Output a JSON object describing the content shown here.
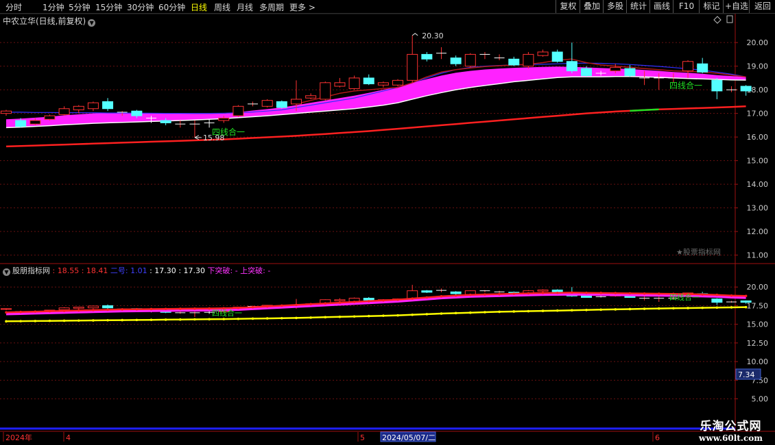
{
  "toolbar": {
    "periods": [
      "分时",
      "1分钟",
      "5分钟",
      "15分钟",
      "30分钟",
      "60分钟",
      "日线",
      "周线",
      "月线",
      "多周期",
      "更多 >"
    ],
    "active_period": "日线",
    "right_buttons": [
      "复权",
      "叠加",
      "多股",
      "统计",
      "画线",
      "F10",
      "标记",
      "+自选",
      "返回"
    ]
  },
  "stock_title": "中农立华(日线,前复权)",
  "indicator_title": {
    "name": "股朋指标网",
    "v1": ": 18.55",
    "v2": ": 18.41",
    "v3_label": "二号",
    "v3": ": 1.01",
    "v4": ": 17.30",
    "v5": ": 17.30",
    "breakdown": "下突破: -",
    "breakout": "上突破: -"
  },
  "annotations": {
    "high": "20.30",
    "low": "15.98",
    "four_line_upper_left": "四线合一",
    "four_line_upper_right": "四线合一",
    "four_line_lower_left": "四线合一",
    "four_line_lower_right": "四线合一"
  },
  "watermark": "★股票指标网",
  "crosshair_value": "7.34",
  "time_axis": {
    "year": "2024年",
    "m4": "4",
    "m5": "5",
    "selected_date": "2024/05/07/二",
    "m6": "6"
  },
  "logo": {
    "line1": "乐淘公式网",
    "line2": "www.60lt.com"
  },
  "colors": {
    "up": "#ff3232",
    "down": "#54ffff",
    "ribbon": "#ff22ff",
    "ma_long": "#ff2020",
    "ma_short": "#b01818",
    "ma_white": "#ffffff",
    "ma_blue": "#3030ff",
    "yellow": "#ffff00"
  },
  "chart_data": {
    "type": "candlestick",
    "main_axis": {
      "ylim": [
        10.7,
        20.7
      ],
      "ticks": [
        "20.00",
        "19.00",
        "18.00",
        "17.00",
        "16.00",
        "15.00",
        "14.00",
        "13.00",
        "12.00",
        "11.00"
      ]
    },
    "indicator_axis": {
      "ylim": [
        3.4,
        21.4
      ],
      "ticks": [
        "20.00",
        "17.50",
        "15.00",
        "12.50",
        "10.00",
        "7.50",
        "5.00"
      ]
    },
    "candles": [
      [
        17.0,
        17.1,
        16.9,
        17.15
      ],
      [
        16.7,
        16.45,
        16.4,
        16.8
      ],
      [
        16.55,
        16.7,
        16.5,
        16.8
      ],
      [
        16.75,
        16.9,
        16.7,
        16.95
      ],
      [
        16.95,
        17.2,
        16.9,
        17.3
      ],
      [
        17.15,
        17.3,
        17.0,
        17.35
      ],
      [
        17.2,
        17.45,
        17.1,
        17.5
      ],
      [
        17.5,
        17.2,
        17.1,
        17.65
      ],
      [
        17.0,
        17.05,
        16.9,
        17.1
      ],
      [
        17.1,
        16.9,
        16.8,
        17.15
      ],
      [
        16.8,
        16.75,
        16.6,
        16.9
      ],
      [
        16.7,
        16.6,
        16.5,
        16.8
      ],
      [
        16.55,
        16.55,
        16.4,
        16.7
      ],
      [
        16.5,
        16.55,
        15.98,
        16.7
      ],
      [
        16.6,
        16.55,
        16.4,
        16.75
      ],
      [
        16.7,
        16.8,
        16.6,
        16.9
      ],
      [
        16.9,
        17.3,
        16.85,
        17.35
      ],
      [
        17.4,
        17.4,
        17.3,
        17.5
      ],
      [
        17.3,
        17.55,
        17.25,
        17.6
      ],
      [
        17.5,
        17.25,
        17.2,
        17.55
      ],
      [
        17.4,
        17.6,
        17.1,
        18.4
      ],
      [
        17.65,
        17.75,
        17.6,
        17.85
      ],
      [
        17.6,
        18.3,
        17.55,
        18.35
      ],
      [
        18.15,
        18.3,
        18.1,
        18.5
      ],
      [
        18.05,
        18.5,
        18.0,
        18.6
      ],
      [
        18.5,
        18.25,
        18.2,
        18.65
      ],
      [
        18.2,
        18.3,
        18.1,
        18.35
      ],
      [
        18.2,
        18.4,
        18.15,
        18.45
      ],
      [
        18.4,
        19.5,
        18.3,
        20.3
      ],
      [
        19.5,
        19.3,
        19.2,
        19.6
      ],
      [
        19.55,
        19.55,
        19.3,
        19.8
      ],
      [
        19.35,
        19.1,
        19.0,
        19.45
      ],
      [
        19.0,
        19.5,
        18.95,
        19.55
      ],
      [
        19.5,
        19.5,
        19.3,
        19.6
      ],
      [
        19.35,
        19.35,
        19.25,
        19.5
      ],
      [
        19.3,
        19.05,
        19.0,
        19.4
      ],
      [
        19.0,
        19.5,
        18.9,
        19.6
      ],
      [
        19.45,
        19.6,
        19.4,
        19.7
      ],
      [
        19.6,
        19.2,
        19.15,
        19.7
      ],
      [
        19.2,
        18.8,
        18.7,
        20.0
      ],
      [
        18.9,
        18.6,
        18.55,
        19.0
      ],
      [
        18.7,
        18.65,
        18.6,
        18.8
      ],
      [
        18.8,
        18.95,
        18.7,
        19.1
      ],
      [
        18.9,
        18.6,
        18.55,
        19.05
      ],
      [
        18.5,
        18.5,
        18.2,
        18.8
      ],
      [
        18.5,
        18.5,
        18.0,
        18.7
      ],
      [
        18.5,
        18.5,
        18.3,
        18.7
      ],
      [
        18.8,
        19.2,
        18.5,
        19.25
      ],
      [
        19.1,
        18.75,
        18.7,
        19.35
      ],
      [
        18.4,
        17.95,
        17.6,
        18.5
      ],
      [
        18.0,
        18.0,
        17.9,
        18.15
      ],
      [
        18.15,
        17.95,
        17.75,
        18.2
      ]
    ],
    "ma_long": [
      15.6,
      15.62,
      15.64,
      15.66,
      15.68,
      15.7,
      15.72,
      15.74,
      15.76,
      15.78,
      15.8,
      15.82,
      15.84,
      15.86,
      15.88,
      15.9,
      15.93,
      15.96,
      15.99,
      16.02,
      16.05,
      16.09,
      16.13,
      16.17,
      16.21,
      16.25,
      16.3,
      16.35,
      16.4,
      16.45,
      16.5,
      16.55,
      16.6,
      16.65,
      16.7,
      16.75,
      16.8,
      16.85,
      16.9,
      16.95,
      17.0,
      17.04,
      17.08,
      17.11,
      17.14,
      17.17,
      17.19,
      17.21,
      17.23,
      17.25,
      17.27,
      17.3
    ],
    "ma_white": [
      16.4,
      16.42,
      16.45,
      16.48,
      16.52,
      16.55,
      16.58,
      16.6,
      16.62,
      16.64,
      16.66,
      16.68,
      16.7,
      16.72,
      16.75,
      16.78,
      16.82,
      16.86,
      16.9,
      16.95,
      17.0,
      17.05,
      17.1,
      17.15,
      17.2,
      17.27,
      17.35,
      17.45,
      17.6,
      17.75,
      17.88,
      18.0,
      18.1,
      18.18,
      18.26,
      18.34,
      18.4,
      18.46,
      18.52,
      18.55,
      18.55,
      18.55,
      18.56,
      18.56,
      18.55,
      18.53,
      18.5,
      18.48,
      18.46,
      18.44,
      18.42,
      18.41
    ],
    "ribbon_top": [
      16.75,
      16.78,
      16.82,
      16.86,
      16.92,
      16.96,
      17.0,
      17.02,
      17.03,
      17.03,
      17.02,
      17.0,
      16.99,
      16.98,
      16.98,
      16.99,
      17.05,
      17.12,
      17.18,
      17.25,
      17.35,
      17.45,
      17.55,
      17.65,
      17.75,
      17.87,
      18.0,
      18.13,
      18.3,
      18.45,
      18.6,
      18.72,
      18.8,
      18.86,
      18.9,
      18.93,
      18.95,
      18.97,
      18.98,
      18.97,
      18.95,
      18.92,
      18.9,
      18.88,
      18.84,
      18.8,
      18.75,
      18.72,
      18.68,
      18.62,
      18.58,
      18.55
    ],
    "ma_short": [
      null,
      null,
      null,
      null,
      null,
      null,
      null,
      null,
      null,
      null,
      null,
      null,
      null,
      null,
      null,
      null,
      null,
      null,
      null,
      null,
      17.4,
      17.55,
      17.7,
      17.85,
      17.95,
      18.0,
      18.05,
      18.1,
      18.3,
      18.55,
      18.75,
      18.85,
      18.92,
      18.98,
      19.02,
      19.05,
      19.08,
      19.15,
      19.25,
      19.3,
      19.15,
      19.05,
      19.0,
      18.95,
      18.9,
      18.85,
      18.8,
      18.78,
      18.75,
      18.7,
      18.62,
      18.55
    ],
    "ma_blue": [
      17.05,
      17.05,
      17.04,
      17.04,
      17.03,
      17.03,
      17.03,
      17.02,
      17.02,
      17.01,
      17.01,
      17.0,
      17.0,
      17.0,
      17.0,
      17.01,
      17.03,
      17.06,
      17.1,
      17.15,
      17.25,
      17.35,
      17.45,
      17.55,
      17.65,
      17.8,
      17.95,
      18.1,
      18.3,
      18.5,
      18.7,
      18.85,
      18.95,
      19.0,
      19.03,
      19.05,
      19.07,
      19.08,
      19.1,
      19.12,
      19.13,
      19.12,
      19.1,
      19.07,
      19.03,
      18.99,
      18.94,
      18.89,
      18.83,
      18.75,
      18.66,
      18.55
    ],
    "ind_red": [
      16.6,
      16.65,
      16.7,
      16.75,
      16.8,
      16.85,
      16.9,
      16.95,
      17.0,
      17.02,
      17.04,
      17.06,
      17.08,
      17.1,
      17.12,
      17.15,
      17.2,
      17.3,
      17.4,
      17.5,
      17.6,
      17.7,
      17.8,
      17.9,
      18.0,
      18.1,
      18.2,
      18.3,
      18.45,
      18.6,
      18.75,
      18.85,
      18.95,
      19.0,
      19.05,
      19.1,
      19.15,
      19.2,
      19.22,
      19.25,
      19.22,
      19.2,
      19.18,
      19.15,
      19.12,
      19.1,
      19.08,
      19.05,
      19.0,
      18.95,
      18.85,
      18.8
    ],
    "ind_magenta": [
      16.3,
      16.35,
      16.4,
      16.45,
      16.5,
      16.55,
      16.6,
      16.65,
      16.7,
      16.72,
      16.74,
      16.76,
      16.78,
      16.8,
      16.82,
      16.85,
      16.9,
      17.0,
      17.1,
      17.2,
      17.3,
      17.4,
      17.5,
      17.6,
      17.7,
      17.8,
      17.9,
      18.0,
      18.15,
      18.3,
      18.45,
      18.55,
      18.65,
      18.7,
      18.75,
      18.8,
      18.85,
      18.9,
      18.92,
      18.95,
      18.92,
      18.9,
      18.88,
      18.85,
      18.82,
      18.8,
      18.78,
      18.75,
      18.7,
      18.65,
      18.55,
      18.5
    ],
    "ind_yellow": [
      15.4,
      15.42,
      15.44,
      15.46,
      15.48,
      15.5,
      15.52,
      15.54,
      15.56,
      15.58,
      15.6,
      15.62,
      15.64,
      15.66,
      15.68,
      15.7,
      15.73,
      15.76,
      15.79,
      15.82,
      15.85,
      15.9,
      15.95,
      16.0,
      16.05,
      16.1,
      16.15,
      16.2,
      16.28,
      16.36,
      16.44,
      16.5,
      16.56,
      16.62,
      16.68,
      16.72,
      16.76,
      16.8,
      16.84,
      16.88,
      16.92,
      16.96,
      17.0,
      17.04,
      17.08,
      17.12,
      17.15,
      17.18,
      17.21,
      17.24,
      17.27,
      17.3
    ]
  }
}
